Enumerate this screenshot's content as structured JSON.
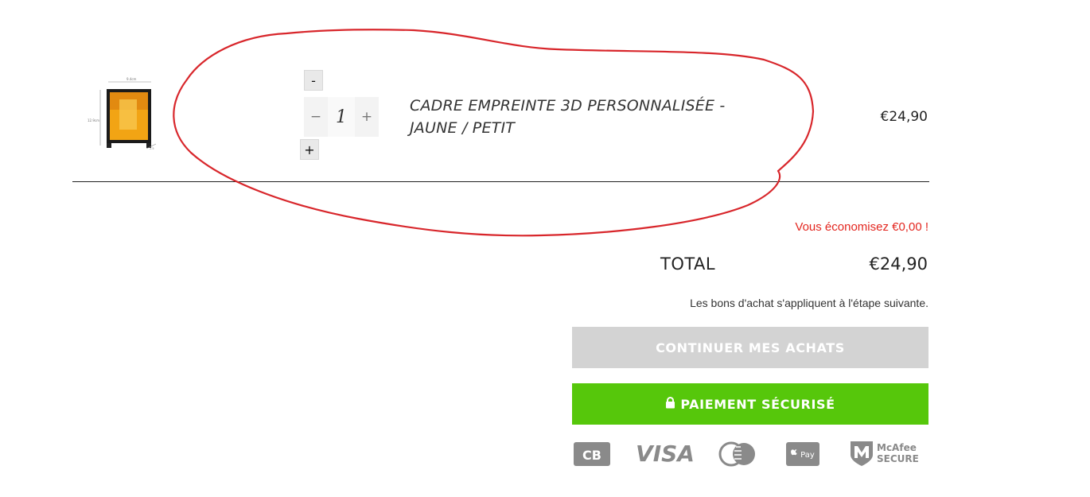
{
  "cart_item": {
    "image_alt": "Cadre empreinte 3D",
    "qty_minus_small": "-",
    "qty_plus_small": "+",
    "qty_minus": "−",
    "qty_plus": "+",
    "quantity": "1",
    "title": "CADRE EMPREINTE 3D PERSONNALISÉE - JAUNE / PETIT",
    "price": "€24,90"
  },
  "summary": {
    "savings": "Vous économisez €0,00 !",
    "total_label": "TOTAL",
    "total_value": "€24,90",
    "voucher_note": "Les bons d'achat s'appliquent à l'étape suivante.",
    "continue_label": "CONTINUER MES ACHATS",
    "checkout_label": "PAIEMENT SÉCURISÉ"
  },
  "payment_icons": {
    "cb": "CB",
    "visa": "VISA",
    "mastercard": "mastercard-icon",
    "applepay": "Pay",
    "mcafee_line1": "McAfee",
    "mcafee_line2": "SECURE"
  },
  "colors": {
    "accent_green": "#56c70b",
    "savings_red": "#e3261f",
    "annotation_red": "#d8262b",
    "disabled_gray": "#d3d3d3"
  }
}
